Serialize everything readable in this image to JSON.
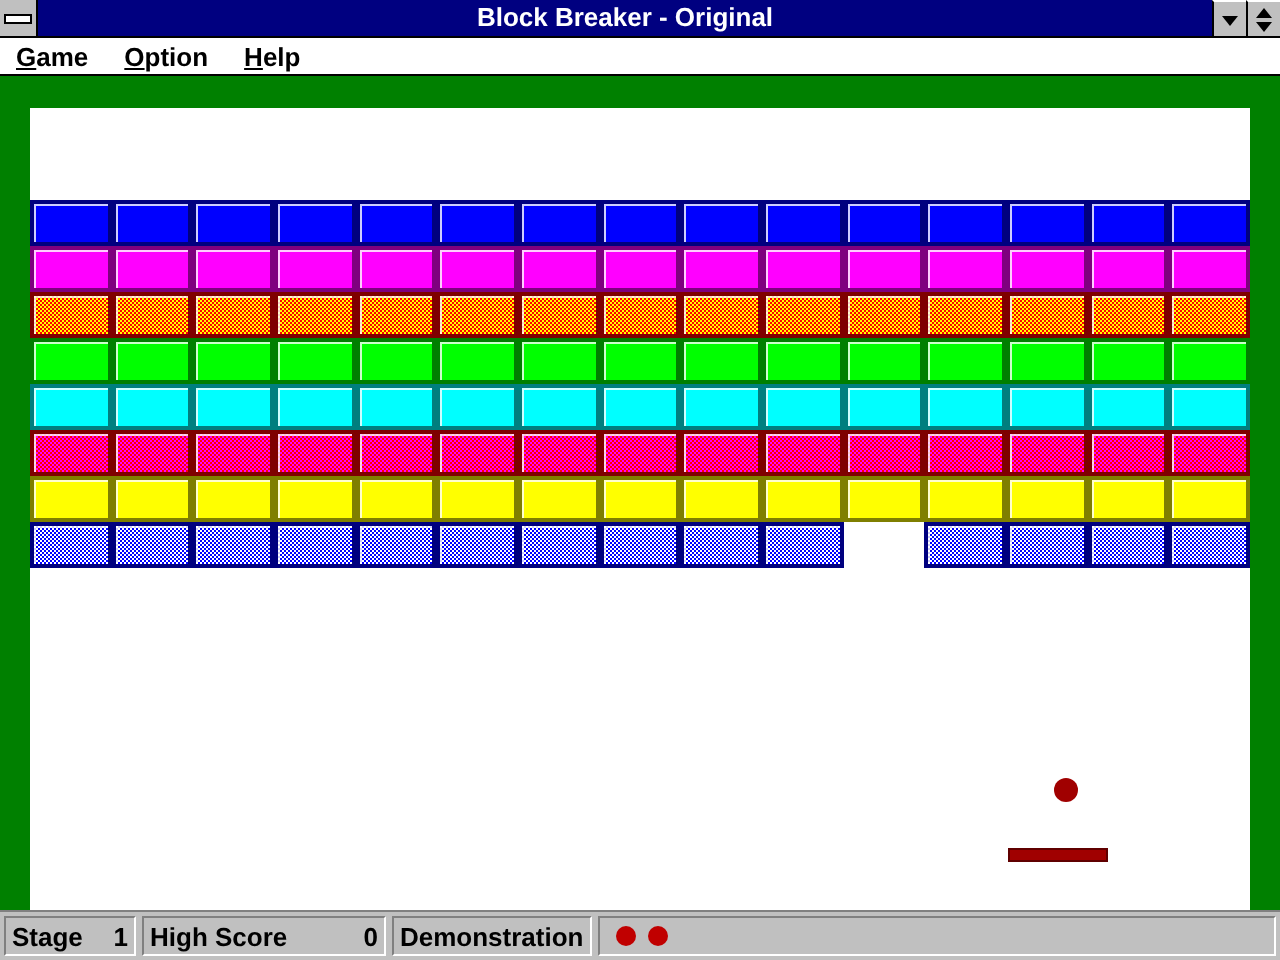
{
  "window": {
    "title": "Block Breaker - Original"
  },
  "menu": [
    "Game",
    "Option",
    "Help"
  ],
  "rows": [
    {
      "kind": "solid",
      "color": "#0000ff",
      "bricks": [
        true,
        true,
        true,
        true,
        true,
        true,
        true,
        true,
        true,
        true,
        true,
        true,
        true,
        true,
        true
      ]
    },
    {
      "kind": "solid",
      "color": "#ff00ff",
      "bricks": [
        true,
        true,
        true,
        true,
        true,
        true,
        true,
        true,
        true,
        true,
        true,
        true,
        true,
        true,
        true
      ]
    },
    {
      "kind": "yellow-checker",
      "color": "#ff0000",
      "bricks": [
        true,
        true,
        true,
        true,
        true,
        true,
        true,
        true,
        true,
        true,
        true,
        true,
        true,
        true,
        true
      ]
    },
    {
      "kind": "solid",
      "color": "#00ff00",
      "bricks": [
        true,
        true,
        true,
        true,
        true,
        true,
        true,
        true,
        true,
        true,
        true,
        true,
        true,
        true,
        true
      ]
    },
    {
      "kind": "solid",
      "color": "#00ffff",
      "bricks": [
        true,
        true,
        true,
        true,
        true,
        true,
        true,
        true,
        true,
        true,
        true,
        true,
        true,
        true,
        true
      ]
    },
    {
      "kind": "magenta-checker",
      "color": "#ff0000",
      "bricks": [
        true,
        true,
        true,
        true,
        true,
        true,
        true,
        true,
        true,
        true,
        true,
        true,
        true,
        true,
        true
      ]
    },
    {
      "kind": "solid",
      "color": "#ffff00",
      "bricks": [
        true,
        true,
        true,
        true,
        true,
        true,
        true,
        true,
        true,
        true,
        true,
        true,
        true,
        true,
        true
      ]
    },
    {
      "kind": "white-checker",
      "color": "#0000ff",
      "bricks": [
        true,
        true,
        true,
        true,
        true,
        true,
        true,
        true,
        true,
        true,
        false,
        true,
        true,
        true,
        true
      ]
    }
  ],
  "status_bar": {
    "stage_label": "Stage",
    "stage": "1",
    "high_score_label": "High Score",
    "high_score": "0",
    "mode": "Demonstration",
    "lives": [
      {
        "kind": "ball"
      },
      {
        "kind": "ball"
      }
    ]
  }
}
